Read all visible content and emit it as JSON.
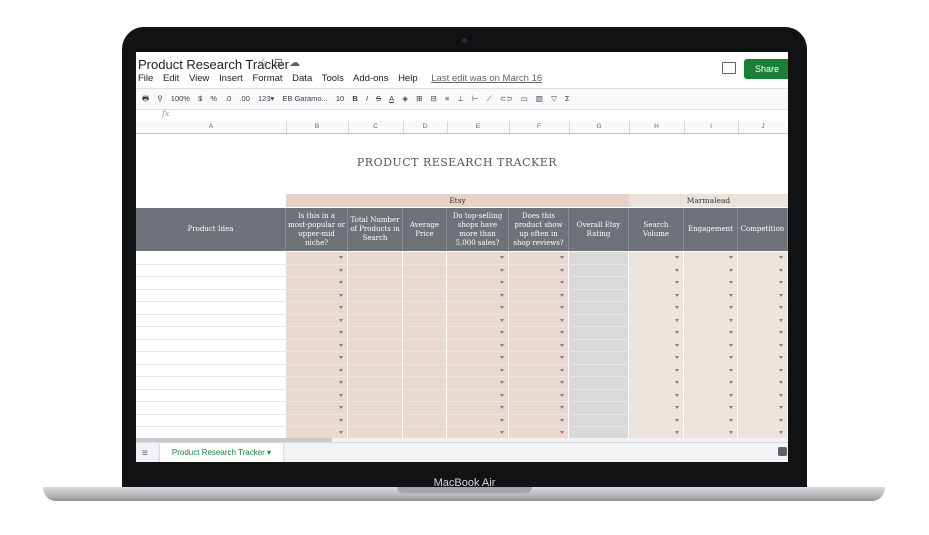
{
  "window": {
    "title": "Product Research Tracker",
    "title_icons": [
      "star-icon",
      "folder-icon",
      "cloud-icon"
    ],
    "menu": [
      "File",
      "Edit",
      "View",
      "Insert",
      "Format",
      "Data",
      "Tools",
      "Add-ons",
      "Help"
    ],
    "last_edit": "Last edit was on March 16",
    "share_label": "Share"
  },
  "toolbar": {
    "zoom": "100%",
    "currency": "$",
    "percent": "%",
    "decimal_less": ".0",
    "decimal_more": ".00",
    "number_format": "123▾",
    "font": "EB Garamo...",
    "font_size": "10",
    "bold": "B",
    "italic": "I",
    "strike": "S",
    "underline_a": "A",
    "sum": "Σ"
  },
  "formula_bar": {
    "fx": "fx"
  },
  "columns": [
    "A",
    "B",
    "C",
    "D",
    "E",
    "F",
    "G",
    "H",
    "I",
    "J"
  ],
  "sheet": {
    "title": "PRODUCT RESEARCH TRACKER",
    "groups": {
      "etsy": "Etsy",
      "marmalead": "Marmalead"
    },
    "headers": [
      "Product Idea",
      "Is this in a most-popular or upper-mid niche?",
      "Total Number of Products in Search",
      "Average Price",
      "Do top-selling shops have more than 5,000 sales?",
      "Does this product show up often in shop reviews?",
      "Overall Etsy Rating",
      "Search Volume",
      "Engagement",
      "Competition"
    ]
  },
  "colors": {
    "header_bg": "#6d7378",
    "etsy_cell": "#ead9ce",
    "rating_cell": "#d9d9d9",
    "marmalead_cell": "#ede3dd",
    "share_green": "#1a7f37"
  },
  "tabs": {
    "active": "Product Research Tracker ▾"
  },
  "device": {
    "brand": "MacBook Air"
  }
}
